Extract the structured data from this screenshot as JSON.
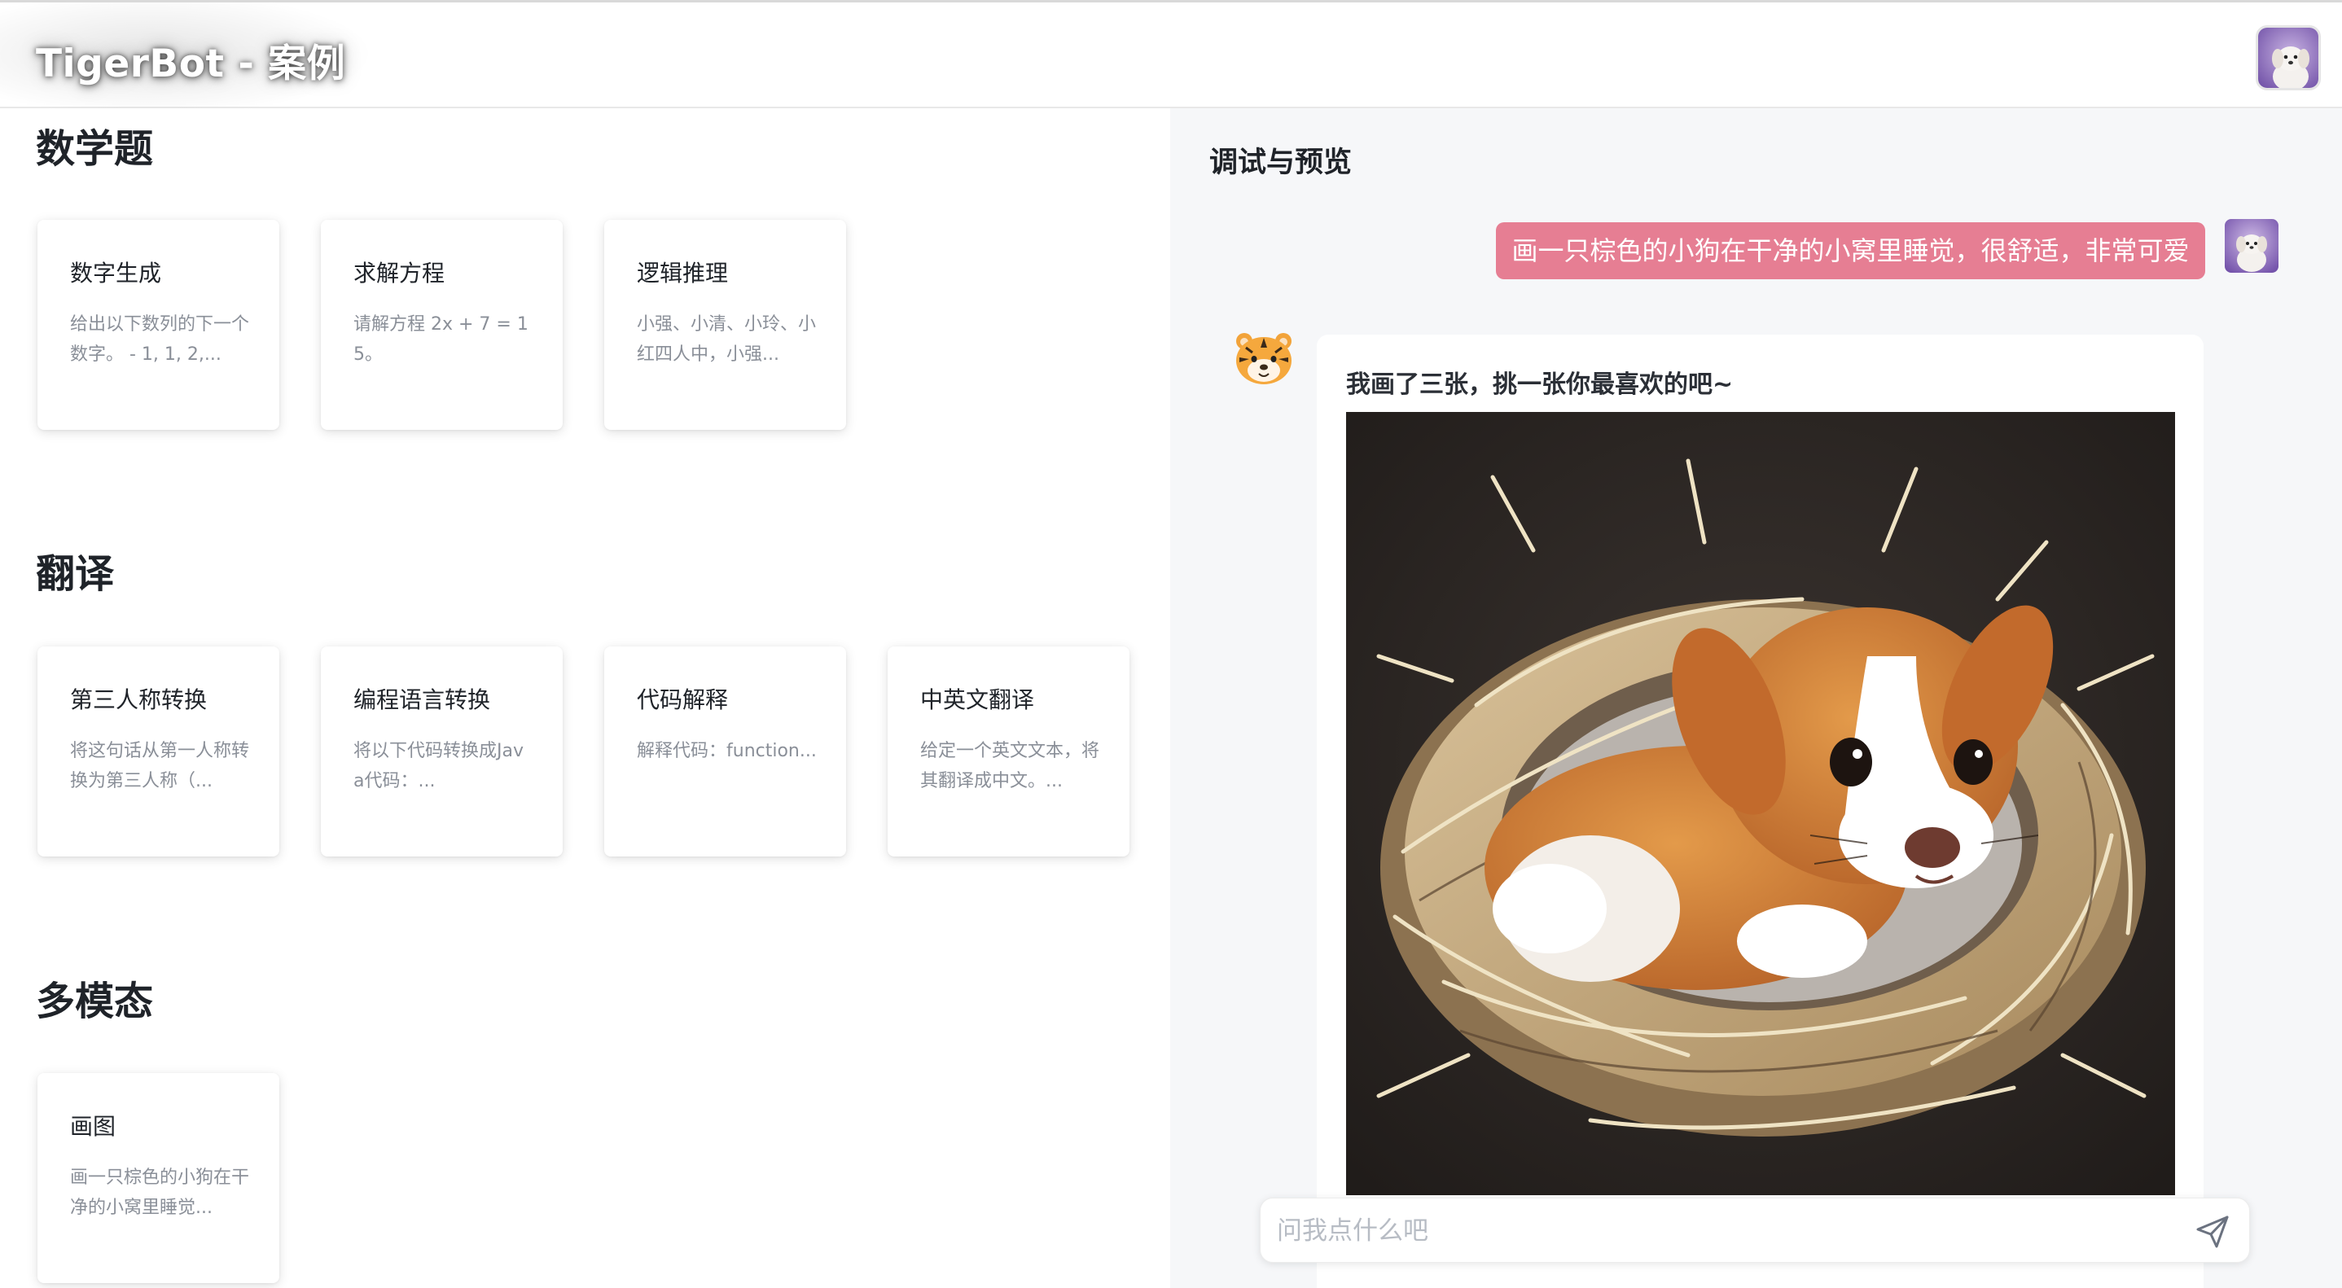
{
  "header": {
    "brand": "TigerBot - 案例"
  },
  "sections": [
    {
      "title": "数学题",
      "cards": [
        {
          "title": "数字生成",
          "desc": "给出以下数列的下一个数字。 - 1, 1, 2,..."
        },
        {
          "title": "求解方程",
          "desc": "请解方程 2x + 7 = 15。"
        },
        {
          "title": "逻辑推理",
          "desc": "小强、小清、小玲、小红四人中，小强..."
        }
      ]
    },
    {
      "title": "翻译",
      "cards": [
        {
          "title": "第三人称转换",
          "desc": "将这句话从第一人称转换为第三人称（..."
        },
        {
          "title": "编程语言转换",
          "desc": "将以下代码转换成Java代码：..."
        },
        {
          "title": "代码解释",
          "desc": "解释代码：function..."
        },
        {
          "title": "中英文翻译",
          "desc": "给定一个英文文本，将其翻译成中文。..."
        }
      ]
    },
    {
      "title": "多模态",
      "cards": [
        {
          "title": "画图",
          "desc": "画一只棕色的小狗在干净的小窝里睡觉..."
        }
      ]
    }
  ],
  "preview": {
    "title": "调试与预览",
    "user_message": "画一只棕色的小狗在干净的小窝里睡觉，很舒适，非常可爱",
    "bot_avatar_emoji": "🐯",
    "bot_reply": "我画了三张，挑一张你最喜欢的吧~",
    "input_placeholder": "问我点什么吧"
  },
  "icons": {
    "send": "send-icon",
    "user_avatar": "puppy-avatar-icon",
    "bot_avatar": "tiger-face-icon"
  },
  "colors": {
    "user_bubble": "#e67e93",
    "right_panel_bg": "#f6f7f9",
    "muted_text": "#8a8f98"
  }
}
